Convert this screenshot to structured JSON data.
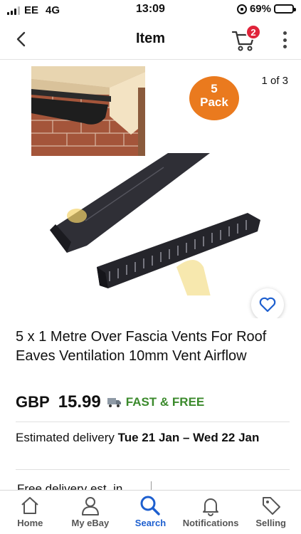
{
  "status_bar": {
    "carrier": "EE",
    "network": "4G",
    "time": "13:09",
    "battery_percent": "69%",
    "battery_level": 0.69
  },
  "nav": {
    "title": "Item",
    "cart_count": "2",
    "icons": {
      "back": "chevron-left-icon",
      "cart": "cart-icon",
      "more": "more-vertical-icon"
    }
  },
  "gallery": {
    "counter": "1 of 3",
    "pack_badge_line1": "5",
    "pack_badge_line2": "Pack",
    "watch_icon": "heart-icon"
  },
  "item": {
    "title": "5  x 1 Metre Over Fascia Vents For Roof Eaves Ventilation 10mm Vent Airflow",
    "price_currency": "GBP",
    "price_value": "15.99",
    "shipping_label": "FAST & FREE",
    "delivery_prefix": "Estimated delivery",
    "delivery_dates": "Tue 21 Jan – Wed 22 Jan",
    "cutoff_text": "Free delivery est. in"
  },
  "tab_bar": {
    "tabs": [
      {
        "label": "Home",
        "icon": "home-icon",
        "active": false
      },
      {
        "label": "My eBay",
        "icon": "user-icon",
        "active": false
      },
      {
        "label": "Search",
        "icon": "search-icon",
        "active": true
      },
      {
        "label": "Notifications",
        "icon": "bell-icon",
        "active": false
      },
      {
        "label": "Selling",
        "icon": "tag-icon",
        "active": false
      }
    ]
  },
  "colors": {
    "accent": "#1d5fcf",
    "badge": "#e0233a",
    "pack_badge": "#ea7a1e",
    "shipping": "#3b8a2c"
  }
}
